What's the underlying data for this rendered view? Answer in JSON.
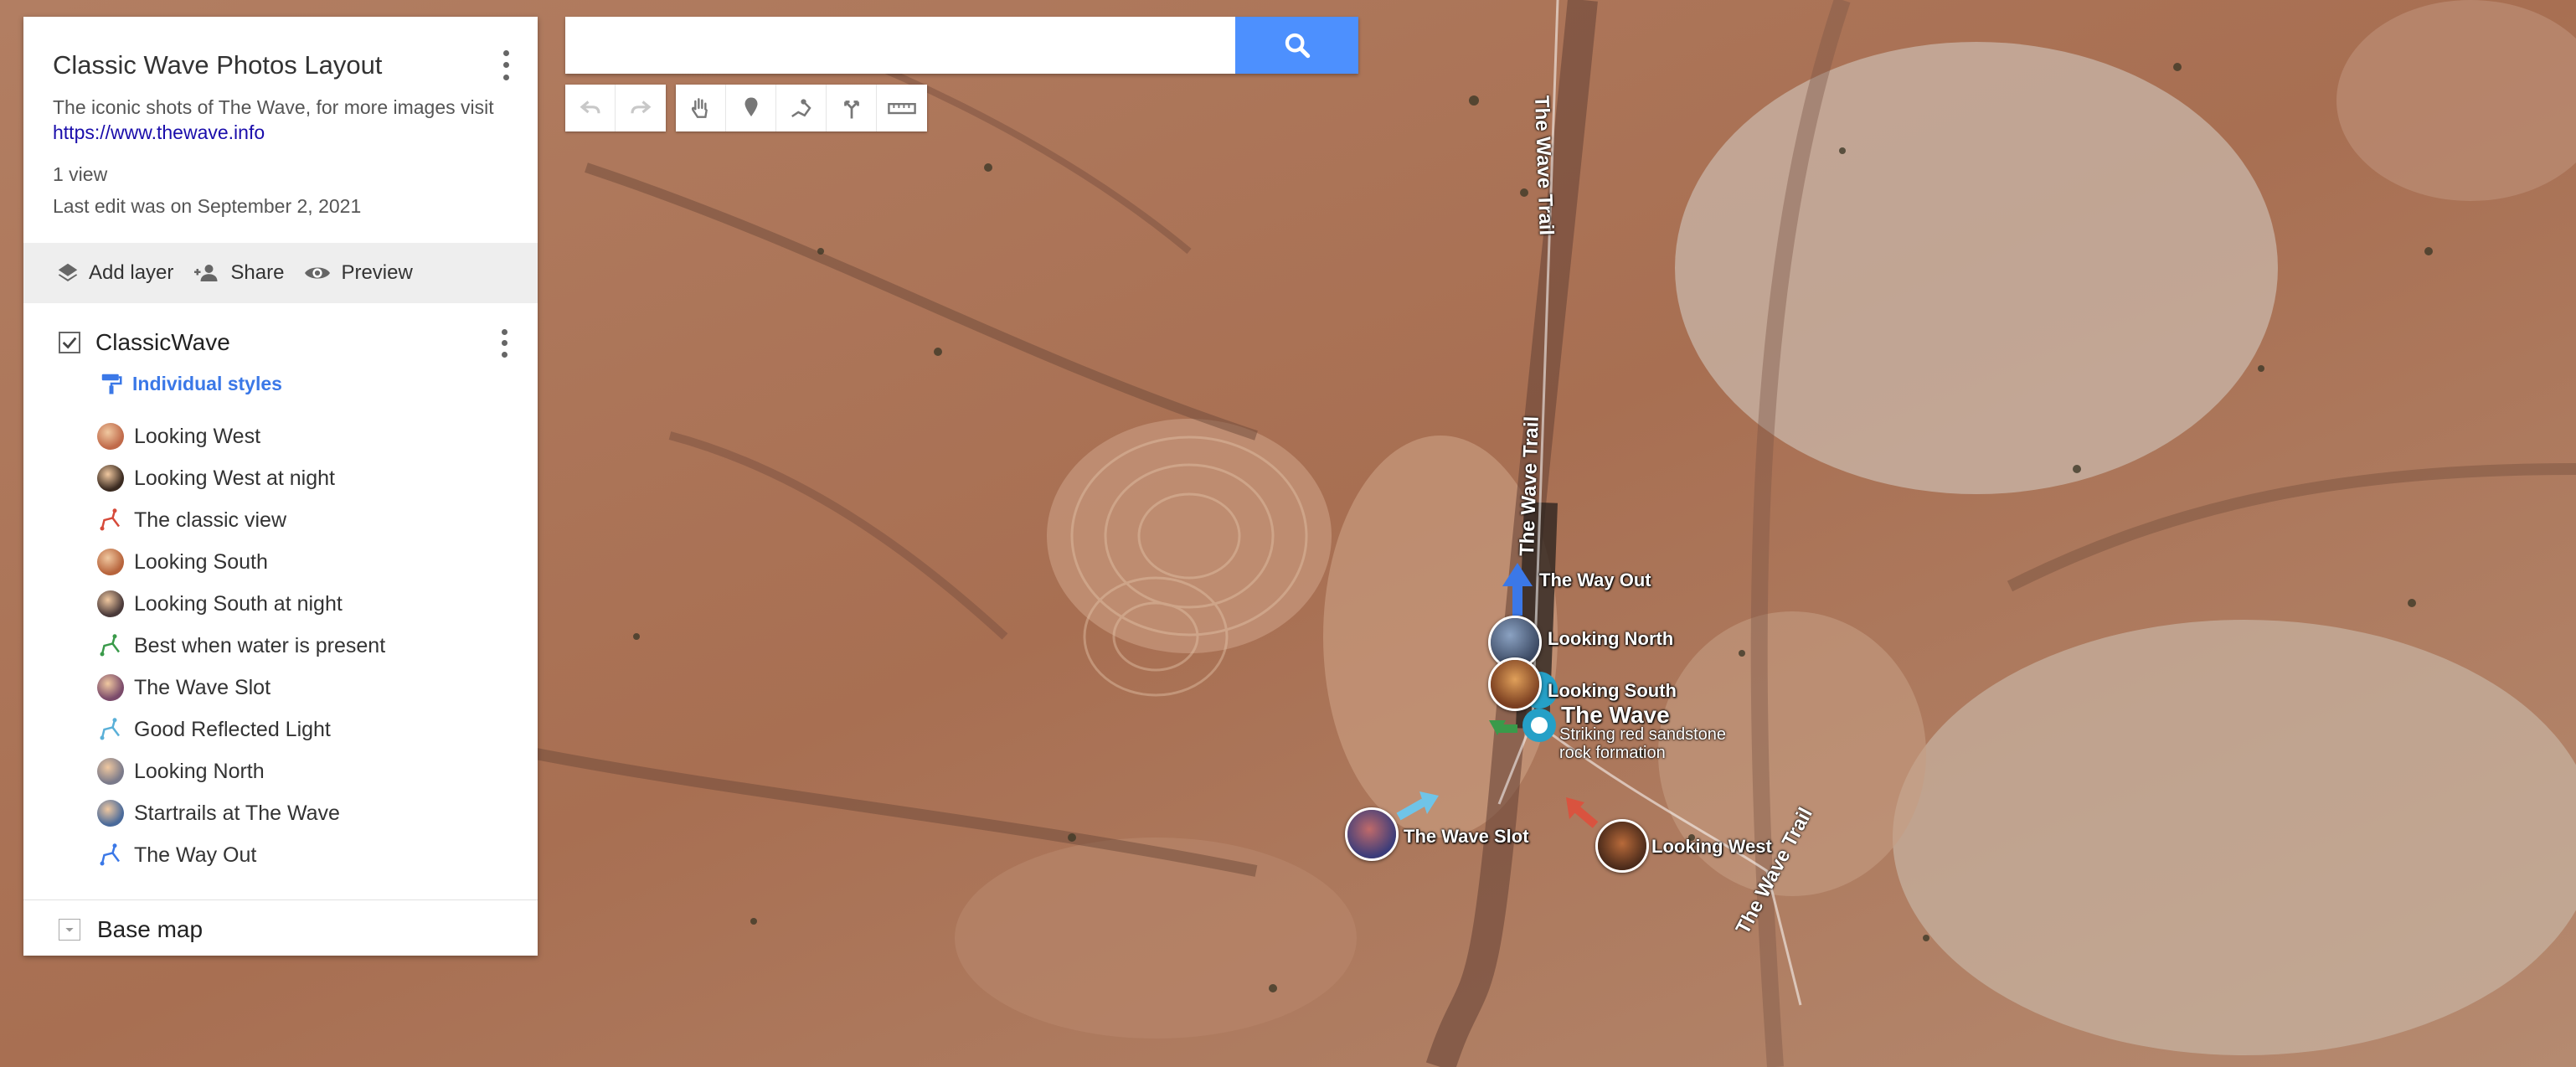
{
  "map": {
    "title": "Classic Wave Photos Layout",
    "description_text": "The iconic shots of The Wave, for more images visit",
    "description_link": "https://www.thewave.info",
    "views": "1 view",
    "last_edit": "Last edit was on September 2, 2021"
  },
  "actions": {
    "add_layer": "Add layer",
    "share": "Share",
    "preview": "Preview"
  },
  "layer": {
    "name": "ClassicWave",
    "checked": true,
    "styles_label": "Individual styles",
    "items": [
      {
        "label": "Looking West",
        "icon": "photo-thumb-icon",
        "color": "#c06a4a"
      },
      {
        "label": "Looking West at night",
        "icon": "photo-thumb-icon",
        "color": "#3a2a20"
      },
      {
        "label": "The classic view",
        "icon": "line-route-icon",
        "color": "#d64a3a"
      },
      {
        "label": "Looking South",
        "icon": "photo-thumb-icon",
        "color": "#b7643c"
      },
      {
        "label": "Looking South at night",
        "icon": "photo-thumb-icon",
        "color": "#4a3a3a"
      },
      {
        "label": "Best when water is present",
        "icon": "line-route-icon",
        "color": "#3a9a4a"
      },
      {
        "label": "The Wave Slot",
        "icon": "photo-thumb-icon",
        "color": "#7a4a6a"
      },
      {
        "label": "Good Reflected Light",
        "icon": "line-route-icon",
        "color": "#5ab0d8"
      },
      {
        "label": "Looking North",
        "icon": "photo-thumb-icon",
        "color": "#7a7a8a"
      },
      {
        "label": "Startrails at The Wave",
        "icon": "photo-thumb-icon",
        "color": "#4a6a9a"
      },
      {
        "label": "The Way Out",
        "icon": "line-route-icon",
        "color": "#3b78e7"
      }
    ]
  },
  "basemap": {
    "label": "Base map"
  },
  "search": {
    "value": "",
    "placeholder": ""
  },
  "map_labels": {
    "the_way_out": "The Way Out",
    "looking_north": "Looking North",
    "looking_south": "Looking South",
    "the_wave": "The Wave",
    "the_wave_desc_1": "Striking red sandstone",
    "the_wave_desc_2": "rock formation",
    "the_wave_slot": "The Wave Slot",
    "looking_west": "Looking West",
    "trail_1": "The Wave Trail",
    "trail_2": "The Wave Trail",
    "trail_3": "The Wave Trail"
  },
  "colors": {
    "search_button": "#4d90fe",
    "styles_link": "#3b78e7",
    "link": "#1a0dab"
  }
}
